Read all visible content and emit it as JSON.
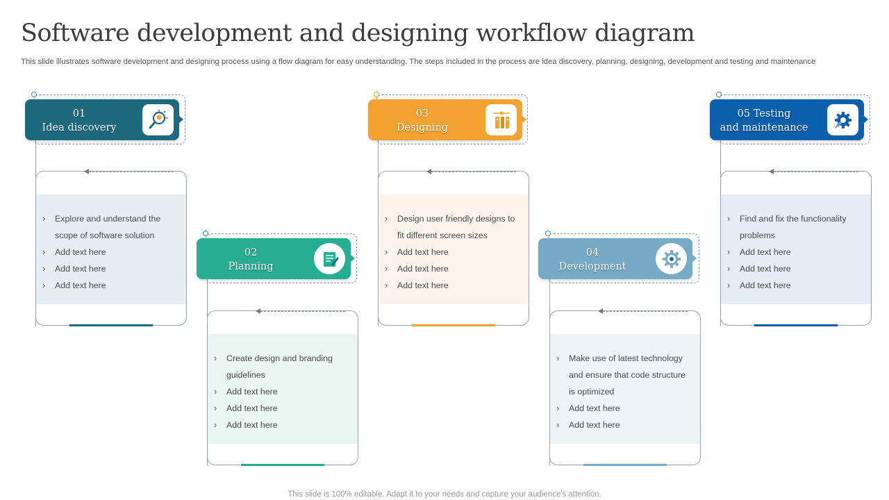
{
  "title": "Software development and designing workflow diagram",
  "subtitle": "This slide illustrates software development and designing process using a flow diagram for easy understanding. The steps included in the process are idea discovery, planning, designing, development and testing and maintenance",
  "footer": "This slide is 100% editable. Adapt it to your needs and capture your audience's attention.",
  "steps": [
    {
      "label_line1": "01",
      "label_line2": "Idea discovery",
      "icon": "idea-search-icon",
      "color": "#1d6a7f",
      "band_color": "#e6eef2",
      "bullets": [
        "Explore and understand the scope of software solution",
        "Add text here",
        "Add text here",
        "Add text here"
      ]
    },
    {
      "label_line1": "02",
      "label_line2": "Planning",
      "icon": "planning-document-icon",
      "color": "#27ad92",
      "band_color": "#e8f5f1",
      "bullets": [
        "Create design and branding guidelines",
        "Add text here",
        "Add text here",
        "Add text here"
      ]
    },
    {
      "label_line1": "03",
      "label_line2": "Designing",
      "icon": "design-tools-icon",
      "color": "#f2a32f",
      "band_color": "#fcf4ea",
      "bullets": [
        "Design user friendly designs to fit different screen sizes",
        "Add text here",
        "Add text here",
        "Add text here"
      ]
    },
    {
      "label_line1": "04",
      "label_line2": "Development",
      "icon": "development-gear-icon",
      "color": "#75abc6",
      "band_color": "#eef4f6",
      "bullets": [
        "Make use of latest technology and ensure that code structure is optimized",
        "Add text here",
        "Add text here"
      ]
    },
    {
      "label_line1": "05 Testing",
      "label_line2": "and maintenance",
      "icon": "maintenance-tools-icon",
      "color": "#0b5fab",
      "band_color": "#e5eef6",
      "bullets": [
        "Find and fix the functionality problems",
        "Add text here",
        "Add text here",
        "Add text here"
      ]
    }
  ]
}
